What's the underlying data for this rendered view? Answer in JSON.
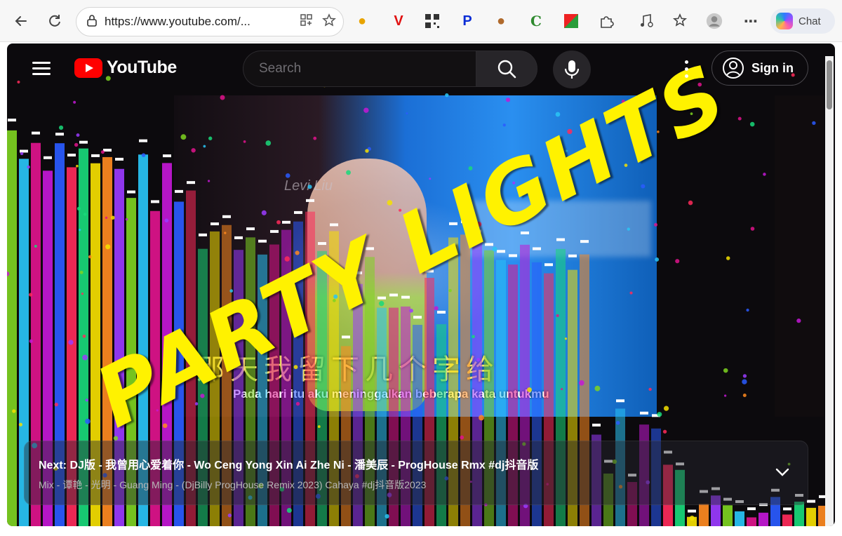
{
  "browser": {
    "url": "https://www.youtube.com/...",
    "chat_label": "Chat"
  },
  "youtube": {
    "logo_text": "YouTube",
    "search_placeholder": "Search",
    "signin_label": "Sign in"
  },
  "video": {
    "overlay_title": "PARTY LIGHTS",
    "watermark": "Levi Liu",
    "lyric_chinese": "那天我留下几个字给",
    "lyric_indonesian": "Pada hari itu aku meninggalkan beberapa kata untukmu"
  },
  "up_next": {
    "title": "Next: DJ版 - 我曾用心爱着你 - Wo Ceng Yong Xin Ai Zhe Ni - 潘美辰 - ProgHouse Rmx #dj抖音版",
    "subtitle": "Mix - 谭艳 - 光明 - Guang Ming - (DjBilly ProgHouse Remix 2023) Cahaya #dj抖音版2023"
  },
  "colors": {
    "accent_red": "#ff0000",
    "overlay_yellow": "#fff200"
  },
  "icons": [
    "back-arrow-icon",
    "refresh-icon",
    "lock-icon",
    "apps-icon",
    "star-icon",
    "hamburger-icon",
    "search-icon",
    "mic-icon",
    "more-icon",
    "account-icon",
    "chevron-down-icon"
  ]
}
